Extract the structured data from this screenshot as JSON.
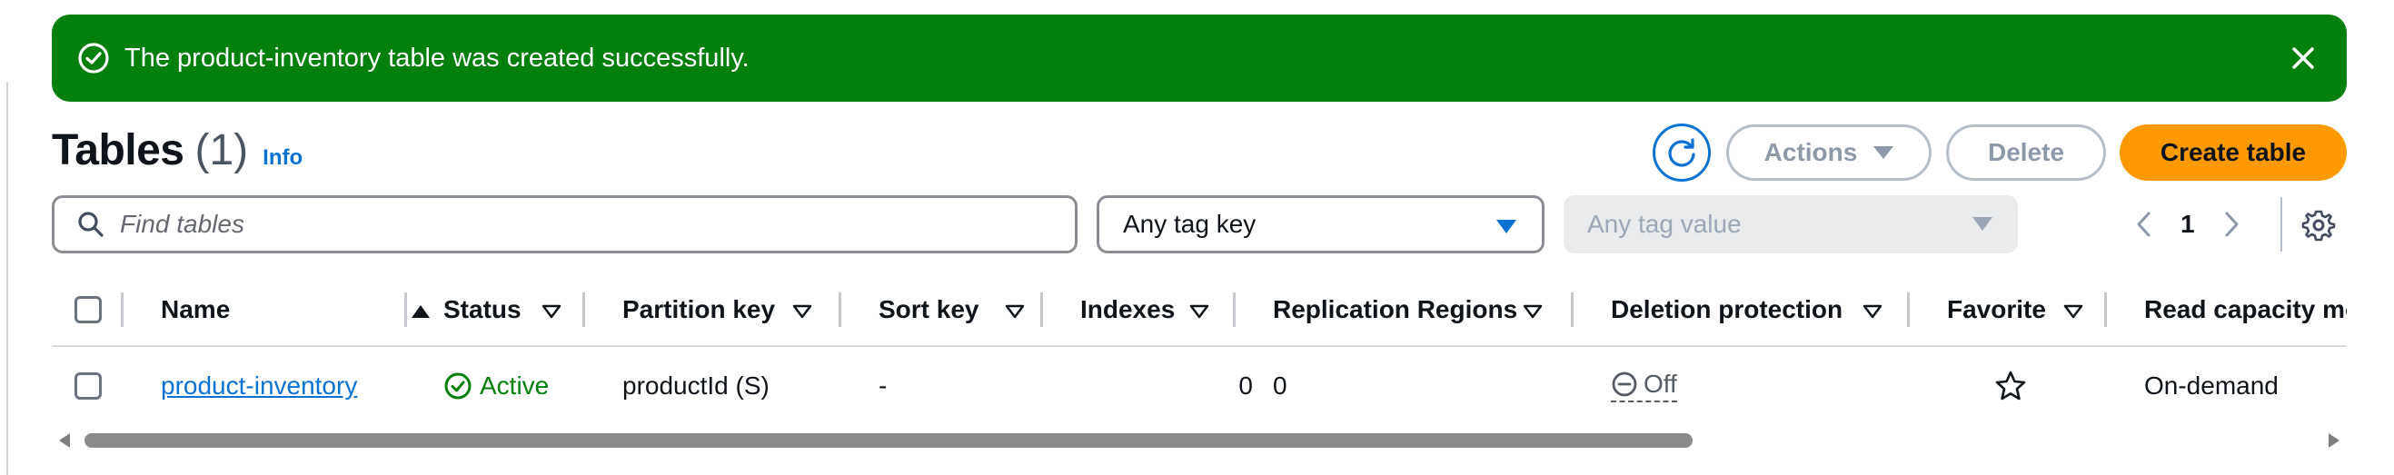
{
  "flash": {
    "message": "The product-inventory table was created successfully.",
    "type": "success",
    "bg_color": "#037f0c"
  },
  "header": {
    "title": "Tables",
    "count": "(1)",
    "info_link": "Info"
  },
  "toolbar": {
    "actions_label": "Actions",
    "delete_label": "Delete",
    "create_label": "Create table",
    "create_color": "#ff9900"
  },
  "filters": {
    "search_placeholder": "Find tables",
    "tag_key_value": "Any tag key",
    "tag_value_placeholder": "Any tag value"
  },
  "pagination": {
    "current_page": "1"
  },
  "table": {
    "columns": [
      {
        "label": "Name",
        "sort": "ascending"
      },
      {
        "label": "Status",
        "sort": "none"
      },
      {
        "label": "Partition key",
        "sort": "none"
      },
      {
        "label": "Sort key",
        "sort": "none"
      },
      {
        "label": "Indexes",
        "sort": "none"
      },
      {
        "label": "Replication Regions",
        "sort": "none"
      },
      {
        "label": "Deletion protection",
        "sort": "none"
      },
      {
        "label": "Favorite",
        "sort": "none"
      },
      {
        "label": "Read capacity mo",
        "sort": "none"
      }
    ],
    "rows": [
      {
        "name": "product-inventory",
        "status": "Active",
        "partition_key": "productId (S)",
        "sort_key": "-",
        "indexes": "0",
        "replication_regions": "0",
        "deletion_protection": "Off",
        "favorite": false,
        "read_capacity_mode": "On-demand"
      }
    ]
  }
}
